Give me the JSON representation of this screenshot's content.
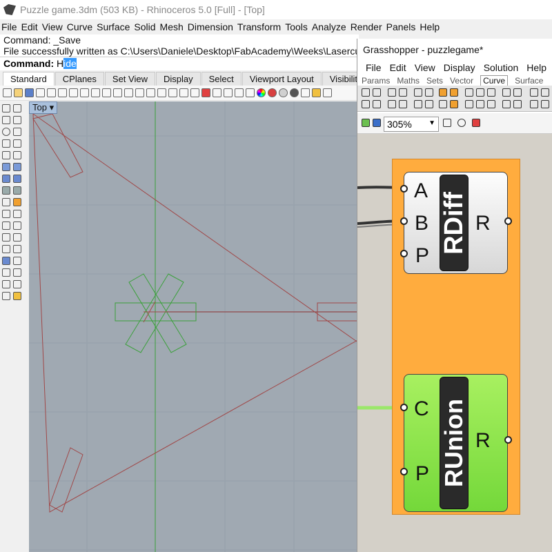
{
  "rhino": {
    "title": "Puzzle game.3dm (503 KB) - Rhinoceros 5.0 [Full] - [Top]",
    "menu": [
      "File",
      "Edit",
      "View",
      "Curve",
      "Surface",
      "Solid",
      "Mesh",
      "Dimension",
      "Transform",
      "Tools",
      "Analyze",
      "Render",
      "Panels",
      "Help"
    ],
    "command_history": [
      "Command: _Save",
      "File successfully written as C:\\Users\\Daniele\\Desktop\\FabAcademy\\Weeks\\Lasercu"
    ],
    "command_label": "Command:",
    "command_typed": "H",
    "command_selected": "ide",
    "toolbar_tabs": [
      "Standard",
      "CPlanes",
      "Set View",
      "Display",
      "Select",
      "Viewport Layout",
      "Visibility"
    ],
    "active_tab": "Standard",
    "viewport_label": "Top",
    "viewport_dropdown": "▾",
    "colors": {
      "viewport_bg": "#a0a9b2",
      "curve": "#a04848",
      "x_axis": "#8b3030",
      "y_axis": "#3aa03a"
    }
  },
  "grasshopper": {
    "title": "Grasshopper - puzzlegame*",
    "menu": [
      "File",
      "Edit",
      "View",
      "Display",
      "Solution",
      "Help"
    ],
    "tabs": [
      "Params",
      "Maths",
      "Sets",
      "Vector",
      "Curve",
      "Surface"
    ],
    "active_tab": "Curve",
    "zoom": "305%",
    "components": [
      {
        "nickname": "RDiff",
        "inputs": [
          "A",
          "B",
          "P"
        ],
        "outputs": [
          "R"
        ],
        "color": "#e0e0e0"
      },
      {
        "nickname": "RUnion",
        "inputs": [
          "C",
          "P"
        ],
        "outputs": [
          "R"
        ],
        "color": "#8ce04c"
      }
    ],
    "colors": {
      "group": "#ffac3e",
      "canvas": "#d4d0c8",
      "wire_green": "#9be76a"
    }
  }
}
